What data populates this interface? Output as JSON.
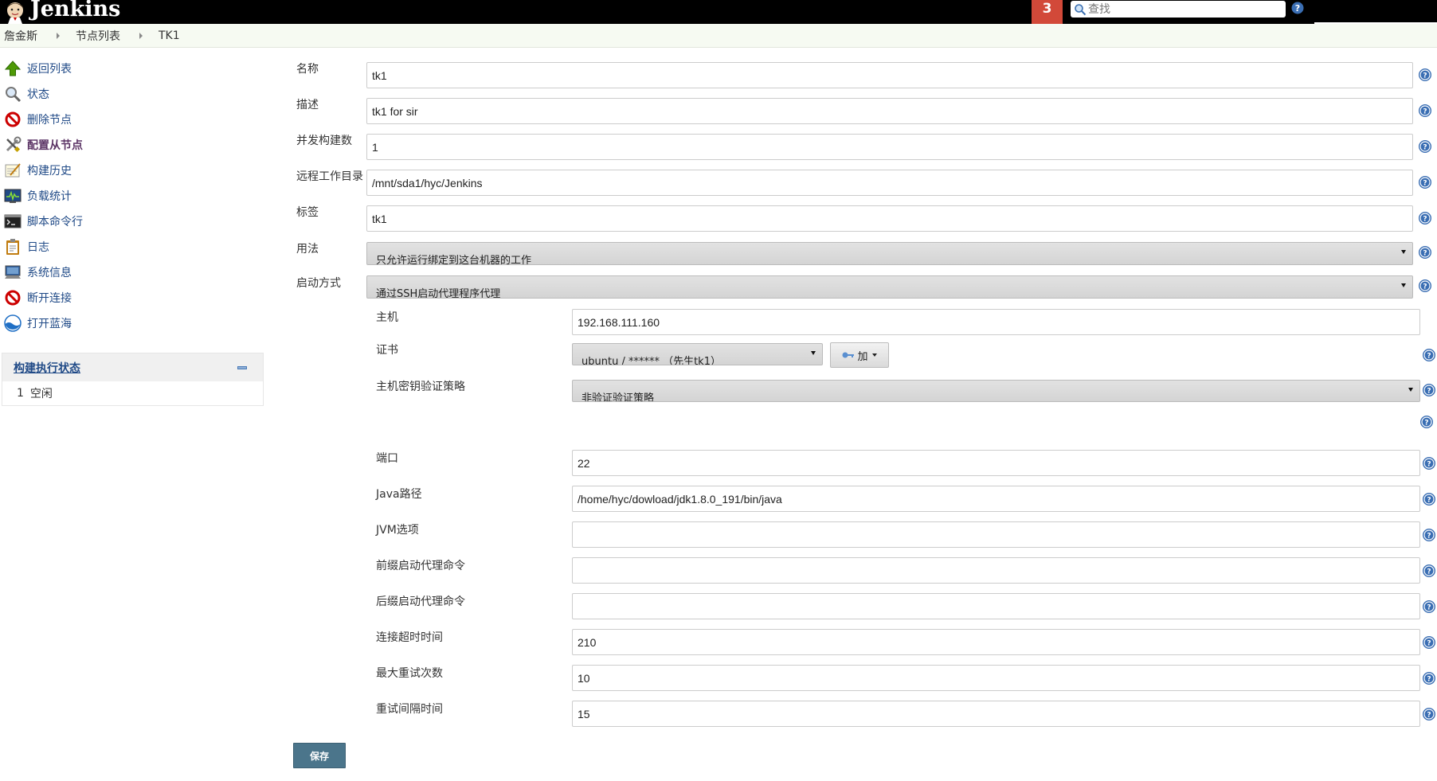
{
  "header": {
    "logo_text": "Jenkins",
    "alert_count": "3",
    "search_placeholder": "查找"
  },
  "breadcrumb": [
    "詹金斯",
    "节点列表",
    "TK1"
  ],
  "sidebar": {
    "tasks": [
      {
        "label": "返回列表",
        "icon": "up-arrow-icon"
      },
      {
        "label": "状态",
        "icon": "magnifier-icon"
      },
      {
        "label": "删除节点",
        "icon": "no-entry-icon"
      },
      {
        "label": "配置从节点",
        "icon": "tools-icon",
        "active": true
      },
      {
        "label": "构建历史",
        "icon": "notepad-icon"
      },
      {
        "label": "负载统计",
        "icon": "monitor-graph-icon"
      },
      {
        "label": "脚本命令行",
        "icon": "terminal-icon"
      },
      {
        "label": "日志",
        "icon": "clipboard-icon"
      },
      {
        "label": "系统信息",
        "icon": "computer-icon"
      },
      {
        "label": "断开连接",
        "icon": "no-entry-icon"
      },
      {
        "label": "打开蓝海",
        "icon": "blue-ocean-icon"
      }
    ],
    "executors": {
      "title": "构建执行状态",
      "rows": [
        {
          "num": "1",
          "status": "空闲"
        }
      ]
    }
  },
  "form": {
    "name": {
      "label": "名称",
      "value": "tk1"
    },
    "description": {
      "label": "描述",
      "value": "tk1 for sir"
    },
    "executors": {
      "label": "并发构建数",
      "value": "1"
    },
    "remote_fs": {
      "label": "远程工作目录",
      "value": "/mnt/sda1/hyc/Jenkins"
    },
    "labels": {
      "label": "标签",
      "value": "tk1"
    },
    "usage": {
      "label": "用法",
      "value": "只允许运行绑定到这台机器的工作"
    },
    "launch": {
      "label": "启动方式",
      "value": "通过SSH启动代理程序代理"
    },
    "host": {
      "label": "主机",
      "value": "192.168.111.160"
    },
    "credentials": {
      "label": "证书",
      "value": "ubuntu / ****** （先生tk1）",
      "add_label": "加"
    },
    "host_key": {
      "label": "主机密钥验证策略",
      "value": "非验证验证策略"
    },
    "port": {
      "label": "端口",
      "value": "22"
    },
    "java_path": {
      "label": "Java路径",
      "value": "/home/hyc/dowload/jdk1.8.0_191/bin/java"
    },
    "jvm_options": {
      "label": "JVM选项",
      "value": ""
    },
    "prefix_cmd": {
      "label": "前缀启动代理命令",
      "value": ""
    },
    "suffix_cmd": {
      "label": "后缀启动代理命令",
      "value": ""
    },
    "timeout": {
      "label": "连接超时时间",
      "value": "210"
    },
    "max_retries": {
      "label": "最大重试次数",
      "value": "10"
    },
    "retry_wait": {
      "label": "重试间隔时间",
      "value": "15"
    },
    "save_label": "保存"
  },
  "colors": {
    "header_bg": "#000000",
    "alert_red": "#d24939",
    "link_blue": "#204a87",
    "save_button": "#4b758b"
  }
}
